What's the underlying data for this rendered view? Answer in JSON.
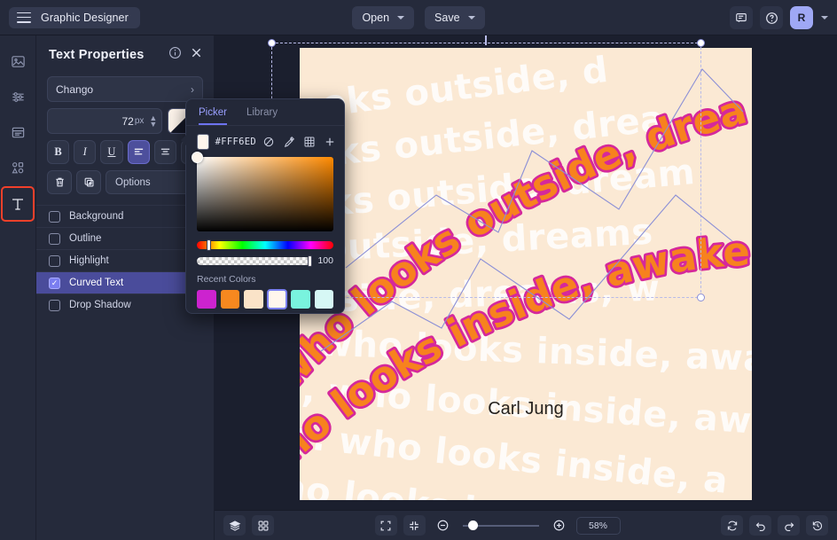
{
  "topbar": {
    "brand_title": "Graphic Designer",
    "menu_icon": "hamburger-icon",
    "open_label": "Open",
    "save_label": "Save",
    "comment_icon": "comment-icon",
    "help_icon": "help-circle-icon",
    "avatar_initial": "R"
  },
  "rail": {
    "items": [
      {
        "icon": "image-icon",
        "name": "image"
      },
      {
        "icon": "adjustments-icon",
        "name": "adjust"
      },
      {
        "icon": "layers-panel-icon",
        "name": "layers"
      },
      {
        "icon": "shapes-icon",
        "name": "shapes"
      },
      {
        "icon": "text-tool-icon",
        "name": "text",
        "label": "T",
        "active": true
      }
    ]
  },
  "panel": {
    "title": "Text Properties",
    "info_icon": "info-icon",
    "close_icon": "close-icon",
    "font_family": "Chango",
    "font_size": "72",
    "font_size_unit": "px",
    "color_swatch": "#FFF6ED",
    "bold_label": "B",
    "italic_label": "I",
    "underline_label": "U",
    "align_left_icon": "align-left-icon",
    "align_center_icon": "align-center-icon",
    "align_right_icon": "align-right-icon",
    "delete_icon": "trash-icon",
    "duplicate_icon": "duplicate-icon",
    "options_label": "Options",
    "checkboxes": [
      {
        "label": "Background",
        "checked": false
      },
      {
        "label": "Outline",
        "checked": false
      },
      {
        "label": "Highlight",
        "checked": false
      },
      {
        "label": "Curved Text",
        "checked": true
      },
      {
        "label": "Drop Shadow",
        "checked": false
      }
    ]
  },
  "picker": {
    "tab_picker": "Picker",
    "tab_library": "Library",
    "hex": "#FFF6ED",
    "no_color_icon": "no-color-icon",
    "eyedropper_icon": "eyedropper-icon",
    "grid_icon": "grid-icon",
    "add_icon": "plus-icon",
    "alpha_value": "100",
    "recent_label": "Recent Colors",
    "recent_colors": [
      "#CC23CF",
      "#F7881F",
      "#FAE3C8",
      "#FFF6ED",
      "#79F3DE",
      "#D6F7F5"
    ],
    "recent_selected_index": 3,
    "accent": "#6D73F0"
  },
  "canvas": {
    "background": "#FBE9D4",
    "text_color": "#F7821E",
    "outline_color": "#D5289B",
    "watermark_color": "#FFFFFF",
    "quote_line1": "who looks outside, dreams;",
    "quote_line2": "who looks inside, awakes.",
    "author": "Carl Jung",
    "watermark_rows": [
      "looks outside, d",
      "looks outside, drea",
      "looks outside, dream",
      "ks outside, dreams",
      "outside, dreams, w",
      "es, who looks inside, awa",
      "kes, who looks inside, aw",
      "akes. who looks inside, a",
      "who looks inside,"
    ]
  },
  "bottombar": {
    "layers_icon": "layers-stack-icon",
    "grid_icon": "grid-view-icon",
    "fit_icon": "fit-screen-icon",
    "shrink_icon": "collapse-icon",
    "zoom_out_icon": "zoom-out-icon",
    "zoom_in_icon": "zoom-in-icon",
    "zoom_value": "58%",
    "refresh_icon": "refresh-icon",
    "undo_icon": "undo-icon",
    "redo_icon": "redo-icon",
    "history_icon": "history-icon"
  }
}
